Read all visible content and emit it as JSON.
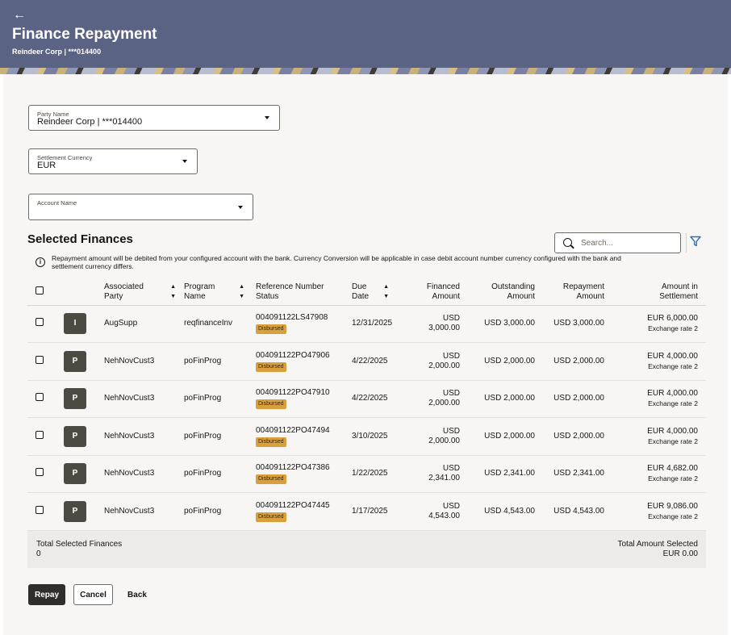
{
  "header": {
    "back_icon": "arrow-left-icon",
    "title": "Finance Repayment",
    "subtitle": "Reindeer Corp | ***014400"
  },
  "form": {
    "party": {
      "label": "Party Name",
      "value": "Reindeer Corp | ***014400"
    },
    "currency": {
      "label": "Settlement Currency",
      "value": "EUR"
    },
    "account": {
      "label": "Account Name",
      "value": ""
    }
  },
  "section_title": "Selected Finances",
  "search": {
    "placeholder": "Search..."
  },
  "info_text": "Repayment amount will be debited from your configured account with the bank. Currency Conversion will be applicable in case debit account number currency configured with the bank and settlement currency differs.",
  "columns": {
    "party": [
      "Associated",
      "Party"
    ],
    "program": [
      "Program",
      "Name"
    ],
    "ref": [
      "Reference Number",
      "Status"
    ],
    "due": [
      "Due",
      "Date"
    ],
    "financed": [
      "Financed",
      "Amount"
    ],
    "outstanding": [
      "Outstanding",
      "Amount"
    ],
    "repayment": [
      "Repayment",
      "Amount"
    ],
    "settlement": [
      "Amount in",
      "Settlement"
    ]
  },
  "rows": [
    {
      "initial": "I",
      "party": "AugSupp",
      "program": "reqfinanceInv",
      "ref": "004091122LS47908",
      "status": "Disbursed",
      "due": "12/31/2025",
      "fin_ccy": "USD",
      "fin_amt": "3,000.00",
      "outstanding": "USD 3,000.00",
      "repayment": "USD 3,000.00",
      "settlement": "EUR 6,000.00",
      "rate": "Exchange rate 2"
    },
    {
      "initial": "P",
      "party": "NehNovCust3",
      "program": "poFinProg",
      "ref": "004091122PO47906",
      "status": "Disbursed",
      "due": "4/22/2025",
      "fin_ccy": "USD",
      "fin_amt": "2,000.00",
      "outstanding": "USD 2,000.00",
      "repayment": "USD 2,000.00",
      "settlement": "EUR 4,000.00",
      "rate": "Exchange rate 2"
    },
    {
      "initial": "P",
      "party": "NehNovCust3",
      "program": "poFinProg",
      "ref": "004091122PO47910",
      "status": "Disbursed",
      "due": "4/22/2025",
      "fin_ccy": "USD",
      "fin_amt": "2,000.00",
      "outstanding": "USD 2,000.00",
      "repayment": "USD 2,000.00",
      "settlement": "EUR 4,000.00",
      "rate": "Exchange rate 2"
    },
    {
      "initial": "P",
      "party": "NehNovCust3",
      "program": "poFinProg",
      "ref": "004091122PO47494",
      "status": "Disbursed",
      "due": "3/10/2025",
      "fin_ccy": "USD",
      "fin_amt": "2,000.00",
      "outstanding": "USD 2,000.00",
      "repayment": "USD 2,000.00",
      "settlement": "EUR 4,000.00",
      "rate": "Exchange rate 2"
    },
    {
      "initial": "P",
      "party": "NehNovCust3",
      "program": "poFinProg",
      "ref": "004091122PO47386",
      "status": "Disbursed",
      "due": "1/22/2025",
      "fin_ccy": "USD",
      "fin_amt": "2,341.00",
      "outstanding": "USD 2,341.00",
      "repayment": "USD 2,341.00",
      "settlement": "EUR 4,682.00",
      "rate": "Exchange rate 2"
    },
    {
      "initial": "P",
      "party": "NehNovCust3",
      "program": "poFinProg",
      "ref": "004091122PO47445",
      "status": "Disbursed",
      "due": "1/17/2025",
      "fin_ccy": "USD",
      "fin_amt": "4,543.00",
      "outstanding": "USD 4,543.00",
      "repayment": "USD 4,543.00",
      "settlement": "EUR 9,086.00",
      "rate": "Exchange rate 2"
    }
  ],
  "totals": {
    "left_label": "Total Selected Finances",
    "left_value": "0",
    "right_label": "Total Amount Selected",
    "right_value": "EUR 0.00"
  },
  "buttons": {
    "repay": "Repay",
    "cancel": "Cancel",
    "back": "Back"
  },
  "colors": {
    "header": "#5b6385",
    "badge": "#d99f3c",
    "primary_button": "#312d2a"
  }
}
